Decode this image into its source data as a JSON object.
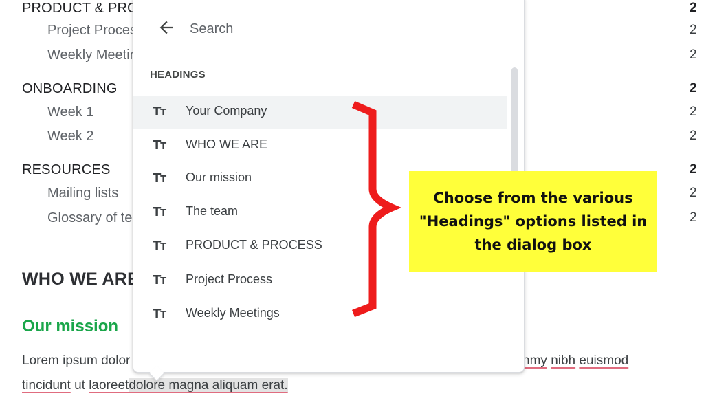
{
  "outline": {
    "rows": [
      {
        "label": "PRODUCT & PROCESS",
        "level": 1,
        "page": "2"
      },
      {
        "label": "Project Process",
        "level": 2,
        "page": "2"
      },
      {
        "label": "Weekly Meetings",
        "level": 2,
        "page": "2"
      },
      {
        "label": "ONBOARDING",
        "level": 1,
        "page": "2"
      },
      {
        "label": "Week 1",
        "level": 2,
        "page": "2"
      },
      {
        "label": "Week 2",
        "level": 2,
        "page": "2"
      },
      {
        "label": "RESOURCES",
        "level": 1,
        "page": "2"
      },
      {
        "label": "Mailing lists",
        "level": 2,
        "page": "2"
      },
      {
        "label": "Glossary of terms",
        "level": 2,
        "page": "2"
      }
    ]
  },
  "document": {
    "heading": "WHO WE ARE",
    "subheading": "Our mission",
    "paragraph_line1_start": "Lorem ipsum dolor sit amet, consectetuer adipiscing elit, sed diam no",
    "paragraph_line1_end": [
      "nmy",
      "nibh",
      "euismod"
    ],
    "paragraph_line2_words": [
      "tincidunt",
      "ut",
      "laoreet"
    ],
    "paragraph_line2_selected": "dolore magna aliquam erat."
  },
  "popup": {
    "back_icon": "arrow-left-icon",
    "search_placeholder": "Search",
    "section_label": "HEADINGS",
    "heading_icon": "text-format-icon",
    "headings": [
      {
        "label": "Your Company",
        "hovered": true
      },
      {
        "label": "WHO WE ARE",
        "hovered": false
      },
      {
        "label": "Our mission",
        "hovered": false
      },
      {
        "label": "The team",
        "hovered": false
      },
      {
        "label": "PRODUCT & PROCESS",
        "hovered": false
      },
      {
        "label": "Project Process",
        "hovered": false
      },
      {
        "label": "Weekly Meetings",
        "hovered": false
      }
    ]
  },
  "annotation": {
    "callout_text": "Choose from the various \"Headings\" options listed  in the dialog box",
    "callout_color": "#ffff3a",
    "brace_color": "#ee1c1c"
  }
}
